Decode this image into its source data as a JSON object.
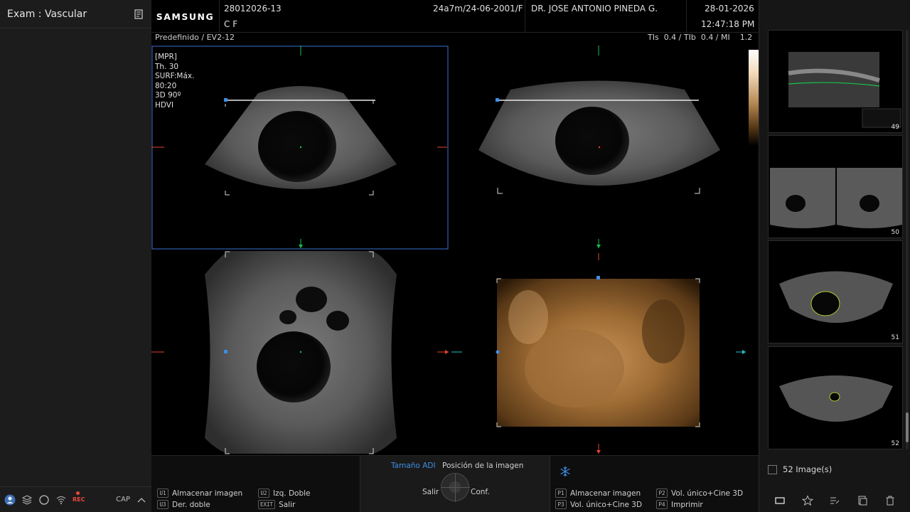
{
  "left_panel": {
    "exam_title": "Exam : Vascular",
    "status_rec": "REC",
    "status_cap": "CAP"
  },
  "header": {
    "brand": "SAMSUNG",
    "patient_id": "28012026-13",
    "patient_info": "24a7m/24-06-2001/F",
    "physician": "DR. JOSE ANTONIO PINEDA G.",
    "date": "28-01-2026",
    "institution": "C F",
    "time": "12:47:18 PM"
  },
  "imaging": {
    "preset": "Predefinido / EV2-12",
    "indices": "TIs  0.4 / TIb  0.4 / MI    1.2",
    "params": [
      "[MPR]",
      "Th. 30",
      "SURF:Máx.",
      "80:20",
      "3D 90º",
      "HDVI"
    ]
  },
  "bottom_bar": {
    "softkeys_left": [
      {
        "key": "U1",
        "label": "Almacenar imagen"
      },
      {
        "key": "U2",
        "label": "Izq. Doble"
      },
      {
        "key": "U3",
        "label": "Der. doble"
      },
      {
        "key": "EXIT",
        "label": "Salir"
      }
    ],
    "mid": {
      "active_tab": "Tamaño ADI",
      "tab2": "Posición de la imagen",
      "left": "Salir",
      "right": "Conf."
    },
    "softkeys_right": [
      {
        "key": "P1",
        "label": "Almacenar imagen"
      },
      {
        "key": "P2",
        "label": "Vol. único+Cine 3D"
      },
      {
        "key": "P3",
        "label": "Vol. único+Cine 3D"
      },
      {
        "key": "P4",
        "label": "Imprimir"
      }
    ]
  },
  "right_panel": {
    "thumbnails": [
      {
        "number": "49"
      },
      {
        "number": "50"
      },
      {
        "number": "51"
      },
      {
        "number": "52"
      }
    ],
    "image_count": "52 Image(s)"
  },
  "colors": {
    "accent_blue": "#3d8ee6",
    "marker_green": "#19c24a",
    "marker_red": "#e0472f",
    "marker_cyan": "#22c3c8",
    "render_3d": "#b07a3a"
  }
}
